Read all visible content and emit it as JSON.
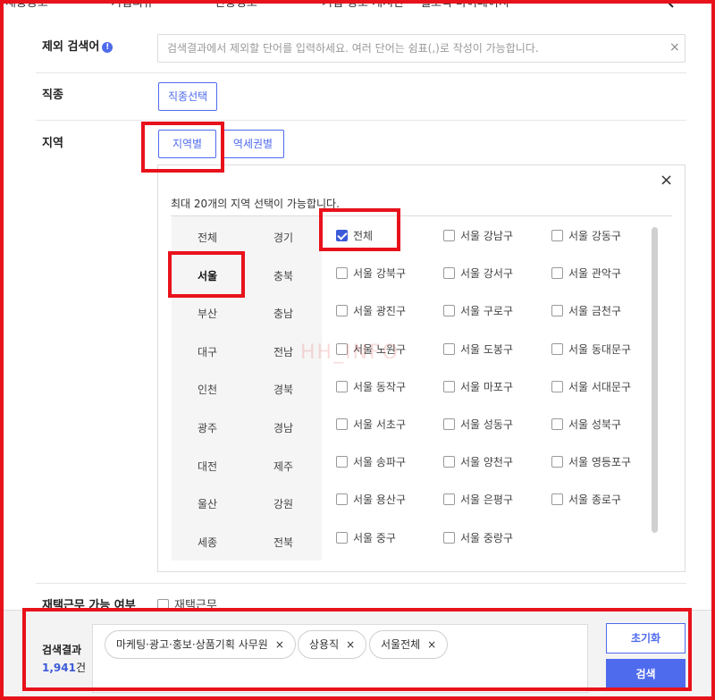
{
  "header": {
    "nav_items": [
      "채용공고",
      "기업리뷰",
      "연봉정보",
      "기업 정보 게시판",
      "헬로퀵 마이페이지"
    ]
  },
  "filters": {
    "exclude": {
      "label": "제외 검색어",
      "info_icon": "info-icon",
      "placeholder": "검색결과에서 제외할 단어를 입력하세요. 여러 단어는 쉼표(,)로 작성이 가능합니다.",
      "clear": "×"
    },
    "job": {
      "label": "직종",
      "button": "직종선택"
    },
    "region": {
      "label": "지역",
      "tabs": [
        "지역별",
        "역세권별"
      ],
      "selected_tab": "지역별",
      "panel": {
        "note": "최대 20개의 지역 선택이 가능합니다.",
        "close": "×",
        "col1": [
          "전체",
          "서울",
          "부산",
          "대구",
          "인천",
          "광주",
          "대전",
          "울산",
          "세종"
        ],
        "col2": [
          "경기",
          "충북",
          "충남",
          "전남",
          "경북",
          "경남",
          "제주",
          "강원",
          "전북"
        ],
        "selected_region": "서울",
        "districts": [
          [
            "전체",
            "서울 강남구",
            "서울 강동구"
          ],
          [
            "서울 강북구",
            "서울 강서구",
            "서울 관악구"
          ],
          [
            "서울 광진구",
            "서울 구로구",
            "서울 금천구"
          ],
          [
            "서울 노원구",
            "서울 도봉구",
            "서울 동대문구"
          ],
          [
            "서울 동작구",
            "서울 마포구",
            "서울 서대문구"
          ],
          [
            "서울 서초구",
            "서울 성동구",
            "서울 성북구"
          ],
          [
            "서울 송파구",
            "서울 양천구",
            "서울 영등포구"
          ],
          [
            "서울 용산구",
            "서울 은평구",
            "서울 종로구"
          ],
          [
            "서울 중구",
            "서울 중랑구",
            ""
          ]
        ],
        "checked": [
          "전체"
        ]
      }
    },
    "remote": {
      "label": "재택근무 가능 여부",
      "option": "재택근무"
    }
  },
  "watermark": "HH_INFO",
  "results": {
    "label": "검색결과",
    "count": "1,941",
    "unit": "건",
    "tags": [
      "마케팅·광고·홍보·상품기획 사무원",
      "상용직",
      "서울전체"
    ],
    "tag_remove": "×",
    "reset_button": "초기화",
    "search_button": "검색"
  },
  "colors": {
    "accent": "#4f6bed",
    "highlight": "#e8121b"
  }
}
